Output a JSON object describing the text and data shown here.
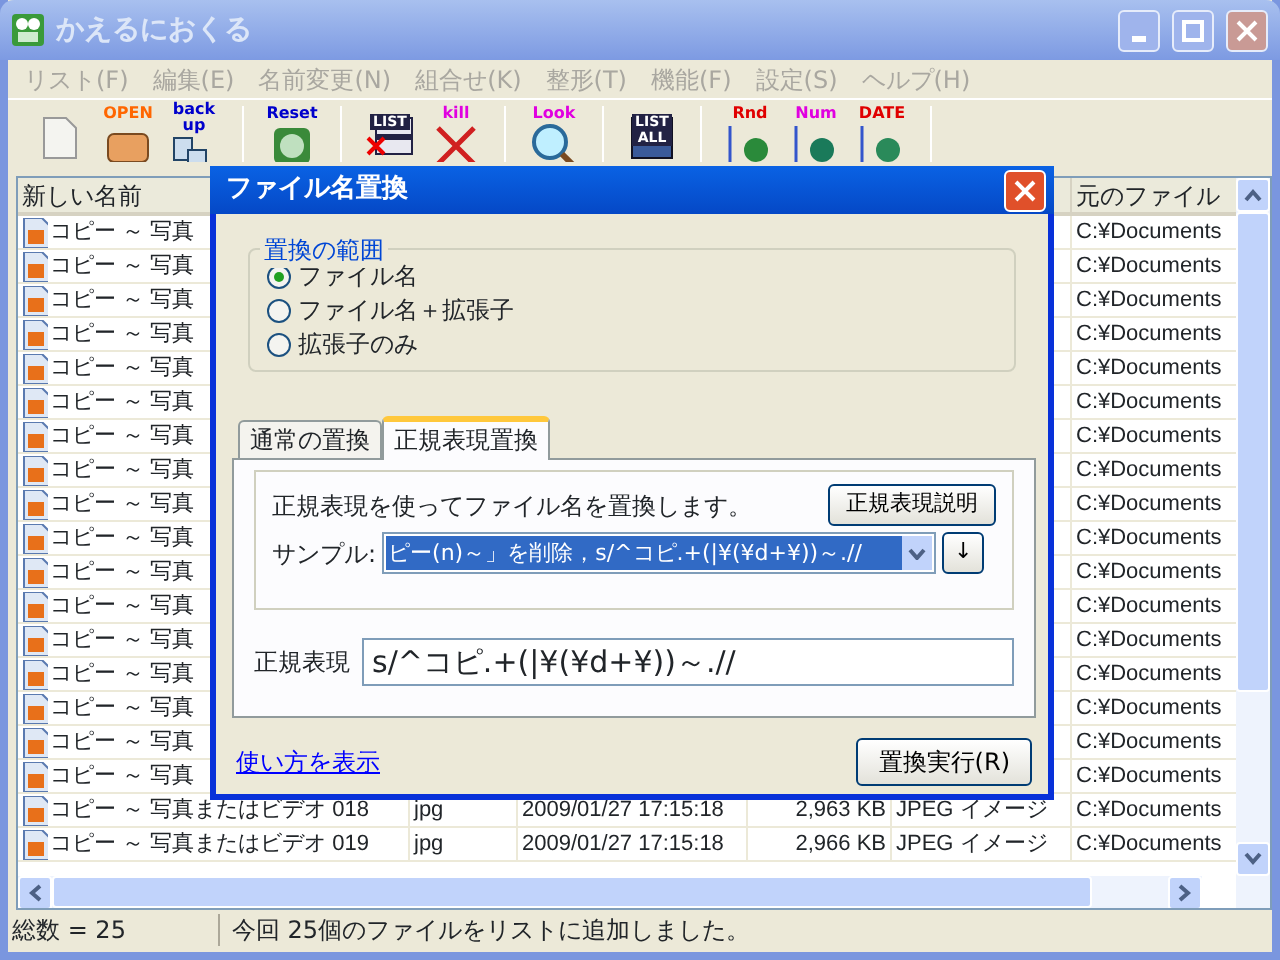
{
  "window": {
    "title": "かえるにおくる"
  },
  "menu": [
    "リスト(F)",
    "編集(E)",
    "名前変更(N)",
    "組合せ(K)",
    "整形(T)",
    "機能(F)",
    "設定(S)",
    "ヘルプ(H)"
  ],
  "toolbar": [
    {
      "kind": "new"
    },
    {
      "kind": "open",
      "label": "OPEN"
    },
    {
      "kind": "backup",
      "label": "back up"
    },
    {
      "kind": "separator"
    },
    {
      "kind": "reset",
      "label": "Reset"
    },
    {
      "kind": "separator"
    },
    {
      "kind": "list",
      "label": "LIST"
    },
    {
      "kind": "kill",
      "label": "kill"
    },
    {
      "kind": "separator"
    },
    {
      "kind": "look",
      "label": "Look"
    },
    {
      "kind": "separator"
    },
    {
      "kind": "listall",
      "label": "LIST ALL"
    },
    {
      "kind": "separator"
    },
    {
      "kind": "rnd",
      "label": "Rnd"
    },
    {
      "kind": "num",
      "label": "Num"
    },
    {
      "kind": "date",
      "label": "DATE"
    },
    {
      "kind": "separator"
    }
  ],
  "table": {
    "header": {
      "name": "新しい名前",
      "path": "元のファイル"
    },
    "rows": [
      {
        "name": "コピー ～ 写真",
        "path": "C:¥Documents"
      },
      {
        "name": "コピー ～ 写真",
        "path": "C:¥Documents"
      },
      {
        "name": "コピー ～ 写真",
        "path": "C:¥Documents"
      },
      {
        "name": "コピー ～ 写真",
        "path": "C:¥Documents"
      },
      {
        "name": "コピー ～ 写真",
        "path": "C:¥Documents"
      },
      {
        "name": "コピー ～ 写真",
        "path": "C:¥Documents"
      },
      {
        "name": "コピー ～ 写真",
        "path": "C:¥Documents"
      },
      {
        "name": "コピー ～ 写真",
        "path": "C:¥Documents"
      },
      {
        "name": "コピー ～ 写真",
        "path": "C:¥Documents"
      },
      {
        "name": "コピー ～ 写真",
        "path": "C:¥Documents"
      },
      {
        "name": "コピー ～ 写真",
        "path": "C:¥Documents"
      },
      {
        "name": "コピー ～ 写真",
        "path": "C:¥Documents"
      },
      {
        "name": "コピー ～ 写真",
        "path": "C:¥Documents"
      },
      {
        "name": "コピー ～ 写真",
        "path": "C:¥Documents"
      },
      {
        "name": "コピー ～ 写真",
        "path": "C:¥Documents"
      },
      {
        "name": "コピー ～ 写真",
        "path": "C:¥Documents"
      },
      {
        "name": "コピー ～ 写真",
        "path": "C:¥Documents"
      },
      {
        "name": "コピー ～ 写真またはビデオ 018",
        "ext": "jpg",
        "date": "2009/01/27 17:15:18",
        "size": "2,963 KB",
        "type": "JPEG イメージ",
        "path": "C:¥Documents"
      },
      {
        "name": "コピー ～ 写真またはビデオ 019",
        "ext": "jpg",
        "date": "2009/01/27 17:15:18",
        "size": "2,966 KB",
        "type": "JPEG イメージ",
        "path": "C:¥Documents"
      }
    ]
  },
  "dialog": {
    "title": "ファイル名置換",
    "scope": {
      "title": "置換の範囲",
      "options": [
        {
          "label": "ファイル名",
          "selected": true
        },
        {
          "label": "ファイル名＋拡張子",
          "selected": false
        },
        {
          "label": "拡張子のみ",
          "selected": false
        }
      ]
    },
    "tabs": [
      {
        "label": "通常の置換",
        "selected": false
      },
      {
        "label": "正規表現置換",
        "selected": true
      }
    ],
    "description": "正規表現を使ってファイル名を置換します。",
    "help_button": "正規表現説明",
    "sample_label": "サンプル:",
    "sample_value": "ピー(n)～」を削除，s/^コピ.+(|¥(¥d+¥))～.//",
    "insert_button": "↓",
    "regex_label": "正規表現",
    "regex_value": "s/^コピ.+(|¥(¥d+¥))～.//",
    "usage_link": "使い方を表示",
    "run_button": "置換実行(R)"
  },
  "status_bar": {
    "total": "総数 = 25",
    "message": "今回 25個のファイルをリストに追加しました。"
  }
}
